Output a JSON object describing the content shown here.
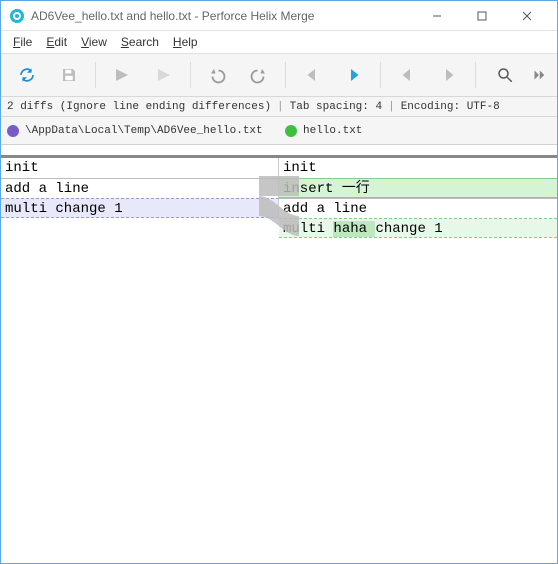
{
  "window": {
    "title": "AD6Vee_hello.txt and hello.txt - Perforce Helix Merge"
  },
  "menu": {
    "file": "File",
    "edit": "Edit",
    "view": "View",
    "search": "Search",
    "help": "Help"
  },
  "icons": {
    "refresh": "refresh-icon",
    "save": "save-icon",
    "tag1": "flag-icon",
    "tag2": "flag-clear-icon",
    "undo": "undo-icon",
    "redo": "redo-icon",
    "prev_blue": "prev-diff-icon",
    "next_blue": "next-diff-icon",
    "prev_gray": "prev-conflict-icon",
    "next_gray": "next-conflict-icon",
    "search": "search-icon",
    "more": "more-icon"
  },
  "status": {
    "diffs_text": "2 diffs (Ignore line ending differences)",
    "tab_spacing": "Tab spacing: 4",
    "encoding": "Encoding: UTF-8"
  },
  "files": {
    "left_path": "\\AppData\\Local\\Temp\\AD6Vee_hello.txt",
    "right_path": "hello.txt",
    "left_marker_color": "#7a5cc6",
    "right_marker_color": "#3fbf3f"
  },
  "diff": {
    "left_lines": [
      {
        "text": "init",
        "class": "plain first"
      },
      {
        "text": "add a line",
        "class": "plain"
      },
      {
        "text": "multi change 1",
        "class": "change-left"
      }
    ],
    "right_lines": [
      {
        "text": "init",
        "class": "plain first"
      },
      {
        "text": "insert 一行",
        "class": "insert-right"
      },
      {
        "text": "add a line",
        "class": "plain"
      },
      {
        "text_pre": "multi ",
        "text_hl": "haha ",
        "text_post": "change 1",
        "class": "change-right"
      }
    ]
  }
}
